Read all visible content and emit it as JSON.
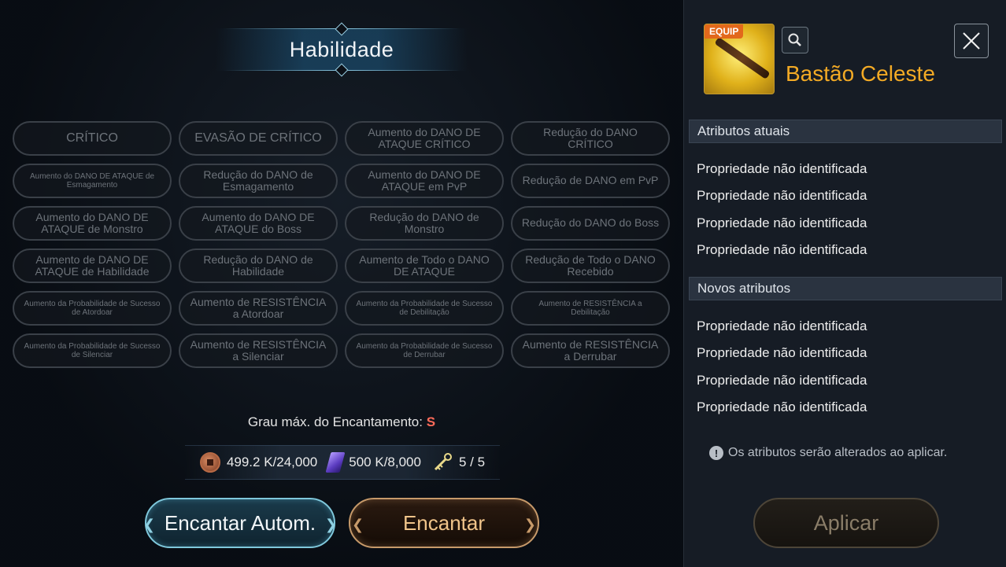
{
  "title": "Habilidade",
  "options": [
    {
      "label": "CRÍTICO",
      "size": "l"
    },
    {
      "label": "EVASÃO DE CRÍTICO",
      "size": "l"
    },
    {
      "label": "Aumento do DANO DE ATAQUE CRÍTICO",
      "size": "m"
    },
    {
      "label": "Redução do DANO CRÍTICO",
      "size": "m"
    },
    {
      "label": "Aumento do DANO DE ATAQUE de Esmagamento",
      "size": "s"
    },
    {
      "label": "Redução do DANO de Esmagamento",
      "size": "m"
    },
    {
      "label": "Aumento do DANO DE ATAQUE em PvP",
      "size": "m"
    },
    {
      "label": "Redução de DANO em PvP",
      "size": "m"
    },
    {
      "label": "Aumento do DANO DE ATAQUE de Monstro",
      "size": "m"
    },
    {
      "label": "Aumento do DANO DE ATAQUE do Boss",
      "size": "m"
    },
    {
      "label": "Redução do DANO de Monstro",
      "size": "m"
    },
    {
      "label": "Redução do DANO do Boss",
      "size": "m"
    },
    {
      "label": "Aumento de DANO DE ATAQUE de Habilidade",
      "size": "m"
    },
    {
      "label": "Redução do DANO de Habilidade",
      "size": "m"
    },
    {
      "label": "Aumento de Todo o DANO DE ATAQUE",
      "size": "m"
    },
    {
      "label": "Redução de Todo o DANO Recebido",
      "size": "m"
    },
    {
      "label": "Aumento da Probabilidade de Sucesso de Atordoar",
      "size": "s"
    },
    {
      "label": "Aumento de RESISTÊNCIA a Atordoar",
      "size": "m"
    },
    {
      "label": "Aumento da Probabilidade de Sucesso de Debilitação",
      "size": "s"
    },
    {
      "label": "Aumento de RESISTÊNCIA a Debilitação",
      "size": "s"
    },
    {
      "label": "Aumento da Probabilidade de Sucesso de Silenciar",
      "size": "s"
    },
    {
      "label": "Aumento de RESISTÊNCIA a Silenciar",
      "size": "m"
    },
    {
      "label": "Aumento da Probabilidade de Sucesso de Derrubar",
      "size": "s"
    },
    {
      "label": "Aumento de RESISTÊNCIA a Derrubar",
      "size": "m"
    }
  ],
  "max_grade": {
    "label": "Grau máx. do Encantamento:",
    "value": "S"
  },
  "costs": [
    {
      "icon": "coin-icon",
      "text": "499.2 K/24,000"
    },
    {
      "icon": "crystal-icon",
      "text": "500 K/8,000"
    },
    {
      "icon": "key-icon",
      "text": "5  / 5"
    }
  ],
  "buttons": {
    "auto": "Encantar Autom.",
    "enchant": "Encantar",
    "apply": "Aplicar"
  },
  "item": {
    "tag": "EQUIP",
    "name": "Bastão Celeste"
  },
  "current_header": "Atributos atuais",
  "current_attrs": [
    "Propriedade não identificada",
    "Propriedade não identificada",
    "Propriedade não identificada",
    "Propriedade não identificada"
  ],
  "new_header": "Novos atributos",
  "new_attrs": [
    "Propriedade não identificada",
    "Propriedade não identificada",
    "Propriedade não identificada",
    "Propriedade não identificada"
  ],
  "note": "Os atributos serão alterados ao aplicar."
}
